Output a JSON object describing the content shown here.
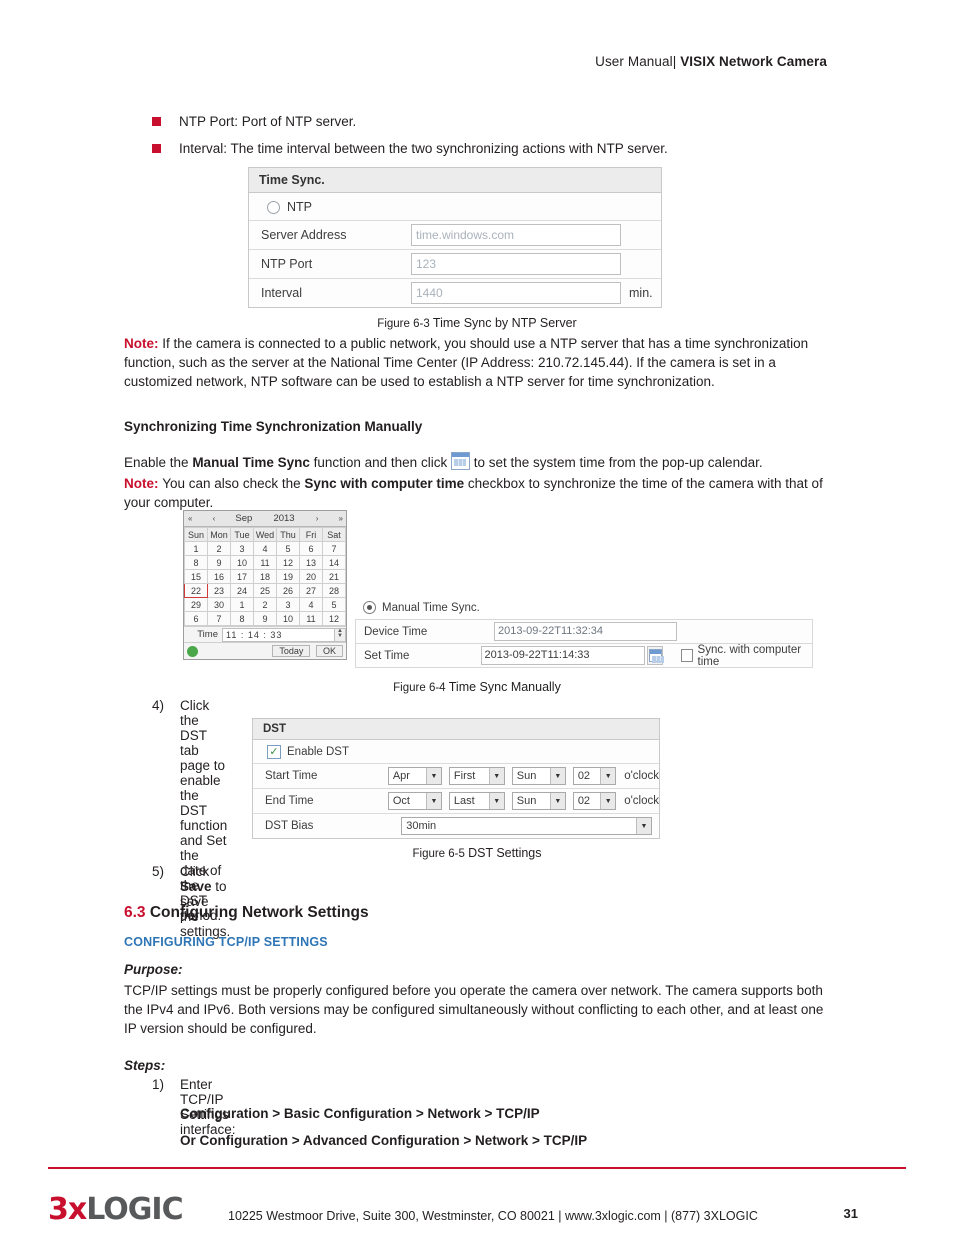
{
  "header": {
    "prefix": "User Manual| ",
    "title": "VISIX Network Camera"
  },
  "bullets": [
    "NTP Port: Port of NTP server.",
    "Interval: The time interval between the two synchronizing actions with NTP server."
  ],
  "time_sync_panel": {
    "title": "Time Sync.",
    "radio_label": "NTP",
    "rows": [
      {
        "label": "Server Address",
        "value": "time.windows.com",
        "unit": ""
      },
      {
        "label": "NTP Port",
        "value": "123",
        "unit": ""
      },
      {
        "label": "Interval",
        "value": "1440",
        "unit": "min."
      }
    ]
  },
  "figures": {
    "fig63": {
      "label": "Figure 6-3 ",
      "caption": "Time Sync by NTP Server"
    },
    "fig64": {
      "label": "Figure 6-4 ",
      "caption": "Time Sync Manually"
    },
    "fig65": {
      "label": "Figure 6-5 ",
      "caption": "DST Settings"
    }
  },
  "note1": {
    "tag": "Note: ",
    "text": "If the camera is connected to a public network, you should use a NTP server that has a time synchronization function, such as the server at the National Time Center (IP Address: 210.72.145.44). If the camera is set in a customized network, NTP software can be used to establish a NTP server for time synchronization."
  },
  "heading_manual": "Synchronizing Time Synchronization Manually",
  "enable_para": {
    "pre": "Enable the ",
    "bold": "Manual Time Sync",
    "mid": " function and then click ",
    "post": " to set the system time from the pop-up calendar."
  },
  "note2": {
    "tag": "Note: ",
    "pre": "You can also check the ",
    "bold": "Sync with computer time",
    "post": " checkbox to synchronize the time of the camera with that of your computer."
  },
  "calendar": {
    "nav_first": "«",
    "nav_prev": "‹",
    "month": "Sep",
    "year": "2013",
    "nav_next": "›",
    "nav_last": "»",
    "weekdays": [
      "Sun",
      "Mon",
      "Tue",
      "Wed",
      "Thu",
      "Fri",
      "Sat"
    ],
    "weeks": [
      [
        {
          "d": "1",
          "s": "cur"
        },
        {
          "d": "2",
          "s": "cur"
        },
        {
          "d": "3",
          "s": "cur"
        },
        {
          "d": "4",
          "s": "cur"
        },
        {
          "d": "5",
          "s": "cur"
        },
        {
          "d": "6",
          "s": "cur"
        },
        {
          "d": "7",
          "s": "cur"
        }
      ],
      [
        {
          "d": "8",
          "s": "cur"
        },
        {
          "d": "9",
          "s": "cur"
        },
        {
          "d": "10",
          "s": "cur"
        },
        {
          "d": "11",
          "s": "cur"
        },
        {
          "d": "12",
          "s": "cur"
        },
        {
          "d": "13",
          "s": "cur"
        },
        {
          "d": "14",
          "s": "cur"
        }
      ],
      [
        {
          "d": "15",
          "s": "cur"
        },
        {
          "d": "16",
          "s": "cur"
        },
        {
          "d": "17",
          "s": "cur"
        },
        {
          "d": "18",
          "s": "cur"
        },
        {
          "d": "19",
          "s": "cur"
        },
        {
          "d": "20",
          "s": "cur"
        },
        {
          "d": "21",
          "s": "cur"
        }
      ],
      [
        {
          "d": "22",
          "s": "sel"
        },
        {
          "d": "23",
          "s": "cur"
        },
        {
          "d": "24",
          "s": "cur"
        },
        {
          "d": "25",
          "s": "cur"
        },
        {
          "d": "26",
          "s": "cur"
        },
        {
          "d": "27",
          "s": "cur"
        },
        {
          "d": "28",
          "s": "cur"
        }
      ],
      [
        {
          "d": "29",
          "s": "cur"
        },
        {
          "d": "30",
          "s": "cur"
        },
        {
          "d": "1",
          "s": "dim"
        },
        {
          "d": "2",
          "s": "dim"
        },
        {
          "d": "3",
          "s": "dim"
        },
        {
          "d": "4",
          "s": "dim"
        },
        {
          "d": "5",
          "s": "dim"
        }
      ],
      [
        {
          "d": "6",
          "s": "dim"
        },
        {
          "d": "7",
          "s": "dim"
        },
        {
          "d": "8",
          "s": "dim"
        },
        {
          "d": "9",
          "s": "dim"
        },
        {
          "d": "10",
          "s": "dim"
        },
        {
          "d": "11",
          "s": "dim"
        },
        {
          "d": "12",
          "s": "dim"
        }
      ]
    ],
    "time_label": "Time",
    "time_value": "11 : 14 : 33",
    "today_button": "Today",
    "ok_button": "OK"
  },
  "manual_sync": {
    "radio_label": "Manual Time Sync.",
    "device_time_label": "Device Time",
    "device_time_value": "2013-09-22T11:32:34",
    "set_time_label": "Set Time",
    "set_time_value": "2013-09-22T11:14:33",
    "sync_checkbox_label": "Sync. with computer time"
  },
  "step4": {
    "num": "4)",
    "text": "Click the DST tab page to enable the DST function and Set the date of the DST period."
  },
  "dst_panel": {
    "title": "DST",
    "enable_label": "Enable DST",
    "check_glyph": "✓",
    "rows": [
      {
        "label": "Start Time",
        "selects": [
          "Apr",
          "First",
          "Sun",
          "02"
        ],
        "suffix": "o'clock"
      },
      {
        "label": "End Time",
        "selects": [
          "Oct",
          "Last",
          "Sun",
          "02"
        ],
        "suffix": "o'clock"
      }
    ],
    "bias_label": "DST Bias",
    "bias_value": "30min"
  },
  "step5": {
    "num": "5)",
    "pre": "Click ",
    "bold": "Save",
    "post": " to save the settings."
  },
  "section": {
    "number": "6.3 ",
    "title": "Configuring Network Settings",
    "subheading": "CONFIGURING TCP/IP SETTINGS",
    "purpose_label": "Purpose:",
    "purpose_text": "TCP/IP settings must be properly configured before you operate the camera over network. The camera supports both the IPv4 and IPv6. Both versions may be configured simultaneously without conflicting to each other, and at least one IP version should be configured.",
    "steps_label": "Steps:",
    "step1_num": "1)",
    "step1_text": "Enter TCP/IP Settings interface:",
    "path1": "Configuration > Basic Configuration > Network > TCP/IP",
    "path2_pre": "Or ",
    "path2": "Configuration > Advanced Configuration > Network > TCP/IP"
  },
  "footer": {
    "logo_3x": "3x",
    "logo_logic": "LOGIC",
    "text": "10225 Westmoor Drive, Suite 300, Westminster, CO 80021 | www.3xlogic.com | (877) 3XLOGIC",
    "page": "31"
  }
}
